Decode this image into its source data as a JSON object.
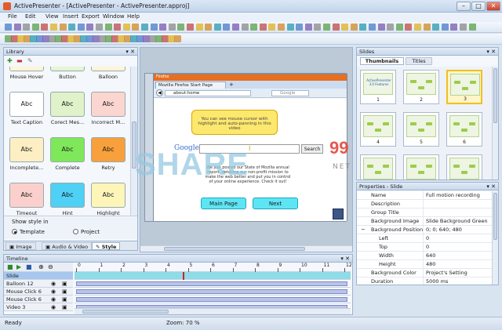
{
  "window": {
    "title": "ActivePresenter - [ActivePresenter - ActivePresenter.approj]"
  },
  "menu": [
    "File",
    "Edit",
    "View",
    "Insert",
    "Export",
    "Window",
    "Help"
  ],
  "library": {
    "title": "Library",
    "items": [
      {
        "label": "Mouse Hover",
        "text": "",
        "color": "#fdf5d9"
      },
      {
        "label": "Button",
        "text": "",
        "color": "#e5f5d5"
      },
      {
        "label": "Balloon",
        "text": "",
        "color": "#fdf5d9"
      },
      {
        "label": "Text Caption",
        "text": "Abc",
        "color": "#ffffff"
      },
      {
        "label": "Corect Mes...",
        "text": "Abc",
        "color": "#dff2c9"
      },
      {
        "label": "Incorrect M...",
        "text": "Abc",
        "color": "#fbd6d0"
      },
      {
        "label": "Incomplete...",
        "text": "Abc",
        "color": "#fdeec4"
      },
      {
        "label": "Complete",
        "text": "Abc",
        "color": "#7ee85a"
      },
      {
        "label": "Retry",
        "text": "Abc",
        "color": "#f7a03c"
      },
      {
        "label": "Timeout",
        "text": "Abc",
        "color": "#fbd0cc"
      },
      {
        "label": "Hint",
        "text": "Abc",
        "color": "#4fd0f5"
      },
      {
        "label": "Highlight",
        "text": "Abc",
        "color": "#fdf6b8"
      }
    ],
    "show_style_in": "Show style in",
    "opt_template": "Template",
    "opt_project": "Project",
    "tabs": [
      "Image",
      "Audio & Video",
      "Style"
    ]
  },
  "canvas": {
    "browser_tab": "Mozilla Firefox Start Page",
    "address": "about:home",
    "search_ph": "Google",
    "note": "You can see mouse cursor with highlight and auto-panning in this video",
    "google": "Google",
    "search_btn": "Search",
    "news": "We just posted our State of Mozilla annual report, detailing our non-profit mission to make the web better and put you in control of your online experience. Check it out!",
    "main_btn": "Main Page",
    "next_btn": "Next",
    "ff_label": "Firefox"
  },
  "watermark": {
    "big": "SHARE",
    "num": "99",
    "net": "NET"
  },
  "slides": {
    "title": "Slides",
    "tab_thumbs": "Thumbnails",
    "tab_titles": "Titles",
    "items": [
      "1",
      "2",
      "3",
      "4",
      "5",
      "6",
      "7",
      "8",
      "9"
    ],
    "first_title": "ActivePresenter 3.0 Features"
  },
  "properties": {
    "title": "Properties - Slide",
    "rows": [
      {
        "k": "Name",
        "v": "Full motion recording",
        "indent": false,
        "exp": ""
      },
      {
        "k": "Description",
        "v": "",
        "indent": false,
        "exp": ""
      },
      {
        "k": "Group Title",
        "v": "",
        "indent": false,
        "exp": ""
      },
      {
        "k": "Background Image",
        "v": "Slide Background Green",
        "indent": false,
        "exp": ""
      },
      {
        "k": "Background Position",
        "v": "0; 0; 640; 480",
        "indent": false,
        "exp": "−"
      },
      {
        "k": "Left",
        "v": "0",
        "indent": true,
        "exp": ""
      },
      {
        "k": "Top",
        "v": "0",
        "indent": true,
        "exp": ""
      },
      {
        "k": "Width",
        "v": "640",
        "indent": true,
        "exp": ""
      },
      {
        "k": "Height",
        "v": "480",
        "indent": true,
        "exp": ""
      },
      {
        "k": "Background Color",
        "v": "Project's Setting",
        "indent": false,
        "exp": ""
      },
      {
        "k": "Duration",
        "v": "5000 ms",
        "indent": false,
        "exp": ""
      }
    ]
  },
  "timeline": {
    "title": "Timeline",
    "ticks": [
      "0",
      "1",
      "2",
      "3",
      "4",
      "5",
      "6",
      "7",
      "8",
      "9",
      "10",
      "11",
      "12"
    ],
    "rows": [
      "Slide",
      "Balloon 12",
      "Mouse Click 6",
      "Mouse Click 6",
      "Video 3"
    ]
  },
  "status": {
    "ready": "Ready",
    "zoom": "Zoom: 70 %"
  }
}
